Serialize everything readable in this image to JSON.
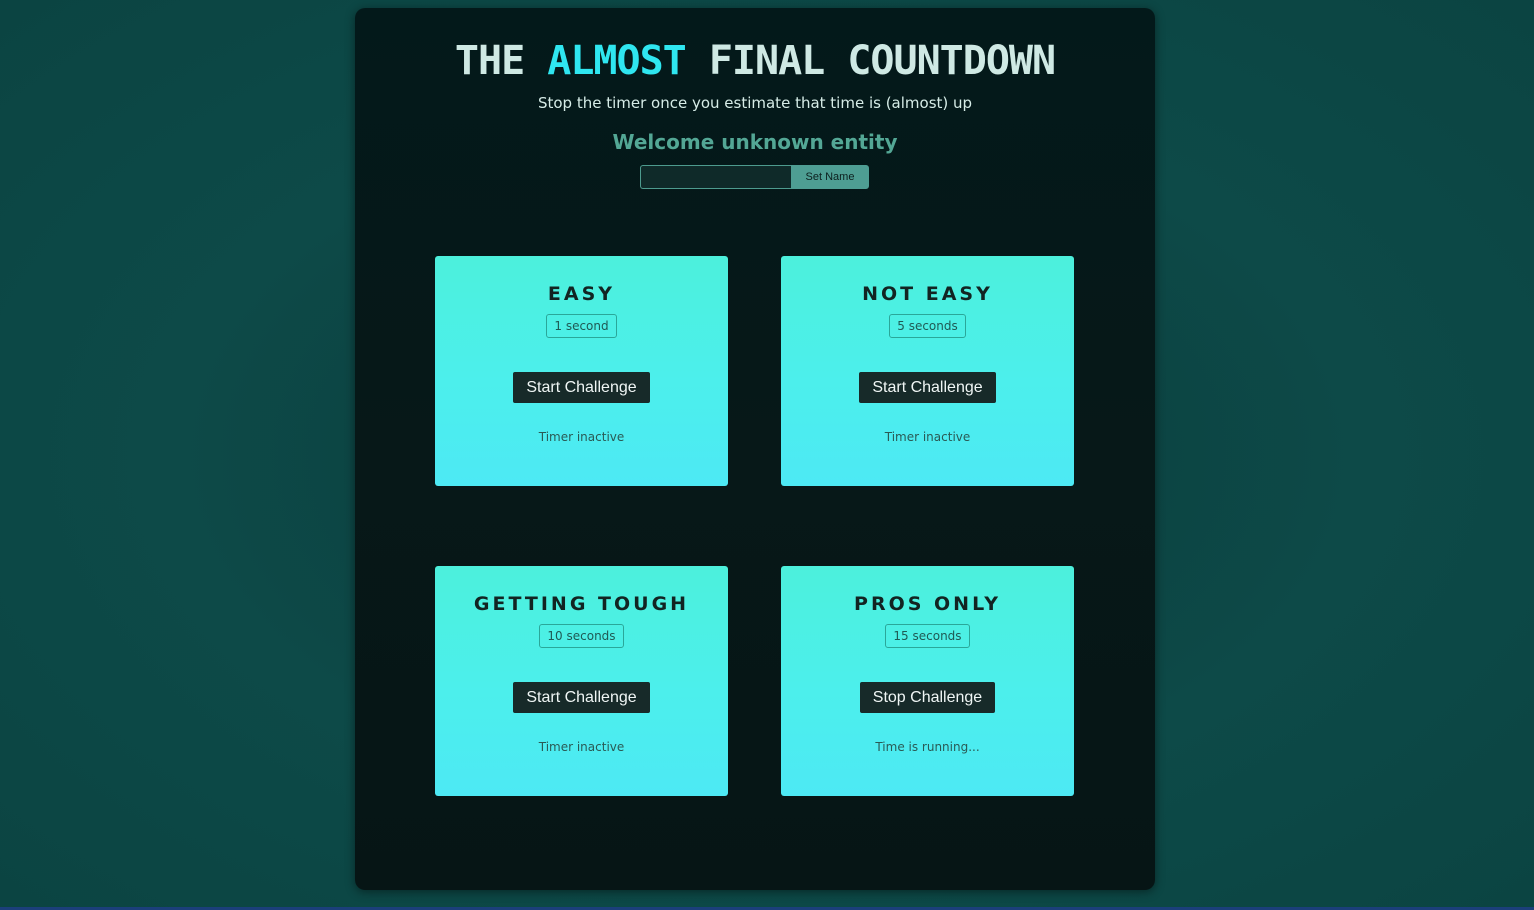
{
  "header": {
    "title_part1": "THE",
    "title_accent": "ALMOST",
    "title_part2": "FINAL COUNTDOWN",
    "subtitle": "Stop the timer once you estimate that time is (almost) up",
    "welcome": "Welcome unknown entity"
  },
  "name_form": {
    "input_value": "",
    "input_placeholder": "",
    "button_label": "Set Name"
  },
  "challenges": [
    {
      "title": "EASY",
      "duration": "1 second",
      "button_label": "Start Challenge",
      "status": "Timer inactive"
    },
    {
      "title": "NOT EASY",
      "duration": "5 seconds",
      "button_label": "Start Challenge",
      "status": "Timer inactive"
    },
    {
      "title": "GETTING TOUGH",
      "duration": "10 seconds",
      "button_label": "Start Challenge",
      "status": "Timer inactive"
    },
    {
      "title": "PROS ONLY",
      "duration": "15 seconds",
      "button_label": "Stop Challenge",
      "status": "Time is running..."
    }
  ],
  "colors": {
    "title_text": "#cfe9e4",
    "title_accent": "#2fe6f0",
    "welcome_text": "#53a795",
    "card_gradient_top": "#4cf0dc",
    "card_gradient_bottom": "#4de9f4",
    "button_dark": "#172a29",
    "set_name_button": "#4e9e93"
  }
}
